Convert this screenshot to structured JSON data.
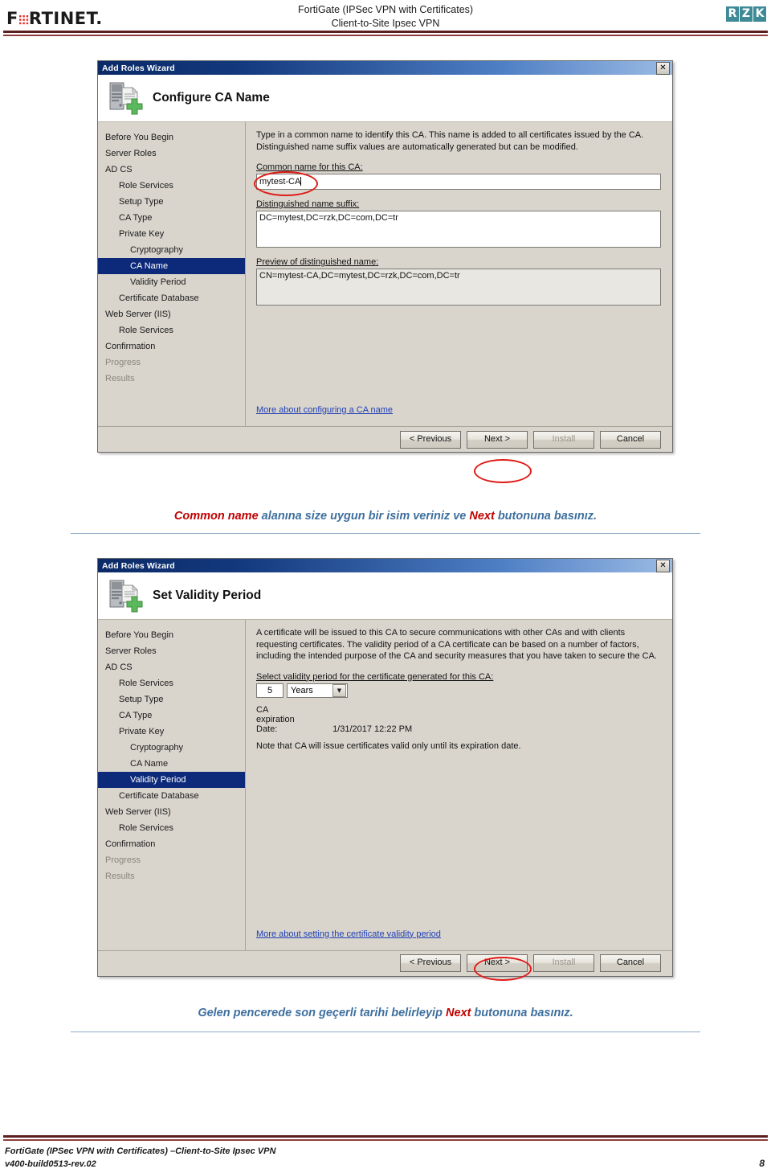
{
  "page_header": {
    "brand_logo": "fortinet-logo",
    "title_line1": "FortiGate (IPSec VPN with Certificates)",
    "title_line2": "Client-to-Site Ipsec VPN",
    "partner_logo_letters": [
      "R",
      "Z",
      "K"
    ]
  },
  "dialog1": {
    "window_title": "Add Roles Wizard",
    "close_label": "✕",
    "banner_title": "Configure CA Name",
    "banner_icon": "server-with-green-plus-icon",
    "nav": [
      {
        "label": "Before You Begin",
        "level": 1,
        "state": "normal"
      },
      {
        "label": "Server Roles",
        "level": 1,
        "state": "normal"
      },
      {
        "label": "AD CS",
        "level": 1,
        "state": "normal"
      },
      {
        "label": "Role Services",
        "level": 2,
        "state": "normal"
      },
      {
        "label": "Setup Type",
        "level": 2,
        "state": "normal"
      },
      {
        "label": "CA Type",
        "level": 2,
        "state": "normal"
      },
      {
        "label": "Private Key",
        "level": 2,
        "state": "normal"
      },
      {
        "label": "Cryptography",
        "level": 3,
        "state": "normal"
      },
      {
        "label": "CA Name",
        "level": 3,
        "state": "selected"
      },
      {
        "label": "Validity Period",
        "level": 3,
        "state": "normal"
      },
      {
        "label": "Certificate Database",
        "level": 2,
        "state": "normal"
      },
      {
        "label": "Web Server (IIS)",
        "level": 1,
        "state": "normal"
      },
      {
        "label": "Role Services",
        "level": 2,
        "state": "normal"
      },
      {
        "label": "Confirmation",
        "level": 1,
        "state": "normal"
      },
      {
        "label": "Progress",
        "level": 1,
        "state": "dim"
      },
      {
        "label": "Results",
        "level": 1,
        "state": "dim"
      }
    ],
    "intro_text": "Type in a common name to identify this CA. This name is added to all certificates issued by the CA. Distinguished name suffix values are automatically generated but can be modified.",
    "common_name_label": "Common name for this CA:",
    "common_name_value": "mytest-CA",
    "dn_suffix_label": "Distinguished name suffix:",
    "dn_suffix_value": "DC=mytest,DC=rzk,DC=com,DC=tr",
    "preview_label": "Preview of distinguished name:",
    "preview_value": "CN=mytest-CA,DC=mytest,DC=rzk,DC=com,DC=tr",
    "more_link": "More about configuring a CA name",
    "buttons": {
      "previous": "< Previous",
      "next": "Next >",
      "install": "Install",
      "cancel": "Cancel"
    }
  },
  "caption1": {
    "part1": "Common name",
    "part2": " alanına size uygun bir isim veriniz ve ",
    "part3": "Next",
    "part4": " butonuna basınız."
  },
  "dialog2": {
    "window_title": "Add Roles Wizard",
    "close_label": "✕",
    "banner_title": "Set Validity Period",
    "banner_icon": "server-with-green-plus-icon",
    "nav": [
      {
        "label": "Before You Begin",
        "level": 1,
        "state": "normal"
      },
      {
        "label": "Server Roles",
        "level": 1,
        "state": "normal"
      },
      {
        "label": "AD CS",
        "level": 1,
        "state": "normal"
      },
      {
        "label": "Role Services",
        "level": 2,
        "state": "normal"
      },
      {
        "label": "Setup Type",
        "level": 2,
        "state": "normal"
      },
      {
        "label": "CA Type",
        "level": 2,
        "state": "normal"
      },
      {
        "label": "Private Key",
        "level": 2,
        "state": "normal"
      },
      {
        "label": "Cryptography",
        "level": 3,
        "state": "normal"
      },
      {
        "label": "CA Name",
        "level": 3,
        "state": "normal"
      },
      {
        "label": "Validity Period",
        "level": 3,
        "state": "selected"
      },
      {
        "label": "Certificate Database",
        "level": 2,
        "state": "normal"
      },
      {
        "label": "Web Server (IIS)",
        "level": 1,
        "state": "normal"
      },
      {
        "label": "Role Services",
        "level": 2,
        "state": "normal"
      },
      {
        "label": "Confirmation",
        "level": 1,
        "state": "normal"
      },
      {
        "label": "Progress",
        "level": 1,
        "state": "dim"
      },
      {
        "label": "Results",
        "level": 1,
        "state": "dim"
      }
    ],
    "intro_text": "A certificate will be issued to this CA to secure communications with other CAs and with clients requesting certificates. The validity period of a CA certificate can be based on a number of factors, including the intended purpose of the CA and security measures that you have taken to secure the CA.",
    "select_label": "Select validity period for the certificate generated for this CA:",
    "validity_value": "5",
    "validity_unit": "Years",
    "expiration_label": "CA expiration Date:",
    "expiration_value": "1/31/2017 12:22 PM",
    "note_text": "Note that CA will issue certificates valid only until its expiration date.",
    "more_link": "More about setting the certificate validity period",
    "buttons": {
      "previous": "< Previous",
      "next": "Next >",
      "install": "Install",
      "cancel": "Cancel"
    }
  },
  "caption2": {
    "part1": "Gelen pencerede son geçerli tarihi belirleyip ",
    "part2": "Next",
    "part3": " butonuna basınız."
  },
  "page_footer": {
    "line1": "FortiGate (IPSec VPN with Certificates) –Client-to-Site Ipsec VPN",
    "line2": "v400-build0513-rev.02",
    "page_number": "8"
  }
}
